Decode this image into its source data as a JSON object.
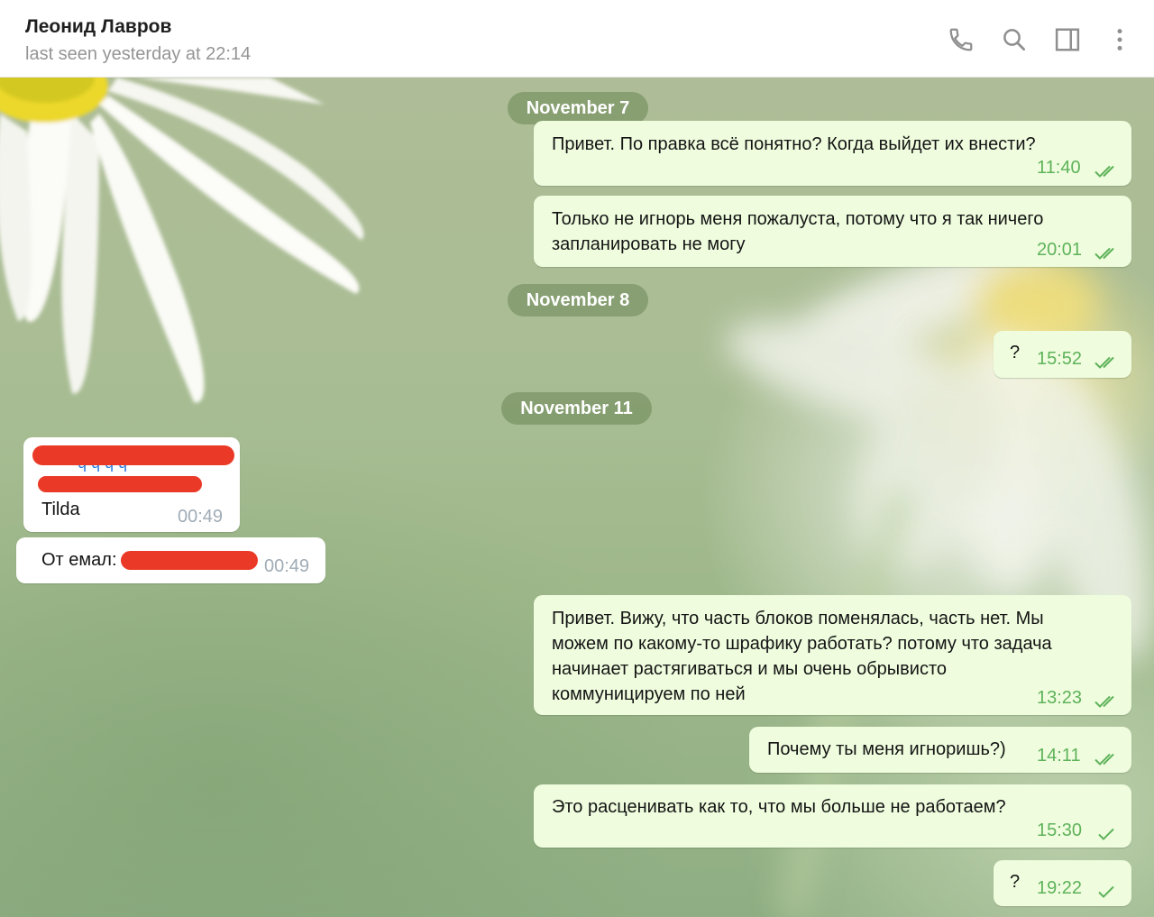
{
  "header": {
    "contact_name": "Леонид Лавров",
    "status": "last seen yesterday at 22:14",
    "icons": [
      "phone-icon",
      "search-icon",
      "sidebar-toggle-icon",
      "more-vertical-icon"
    ]
  },
  "dates": [
    "November 7",
    "November 8",
    "November 11"
  ],
  "messages": [
    {
      "dir": "out",
      "text": "Привет. По правка всё понятно? Когда выйдет их внести?",
      "time": "11:40",
      "status": "read"
    },
    {
      "dir": "out",
      "lines": [
        "Только не игнорь меня пожалуста, потому что я так ничего",
        "запланировать не могу"
      ],
      "time": "20:01",
      "status": "read"
    },
    {
      "dir": "out",
      "text": "?",
      "time": "15:52",
      "status": "read"
    },
    {
      "dir": "in",
      "text": "Tilda",
      "time": "00:49",
      "redacted": true
    },
    {
      "dir": "in",
      "text": "От емал:",
      "time": "00:49",
      "redacted": true
    },
    {
      "dir": "out",
      "lines": [
        "Привет. Вижу, что часть блоков поменялась, часть нет. Мы",
        "можем по какому-то шрафику работать? потому что задача",
        "начинает растягиваться и мы очень обрывисто",
        "коммуницируем по ней"
      ],
      "time": "13:23",
      "status": "read"
    },
    {
      "dir": "out",
      "text": "Почему ты меня игноришь?)",
      "time": "14:11",
      "status": "read"
    },
    {
      "dir": "out",
      "text": "Это расценивать как то, что мы больше не работаем?",
      "time": "15:30",
      "status": "sent"
    },
    {
      "dir": "out",
      "text": "?",
      "time": "19:22",
      "status": "sent"
    }
  ],
  "colors": {
    "outgoing_bubble": "#effdde",
    "incoming_bubble": "#ffffff",
    "time_outgoing": "#5eb25a",
    "redaction": "#ea3a27",
    "date_pill": "#718c5c"
  }
}
